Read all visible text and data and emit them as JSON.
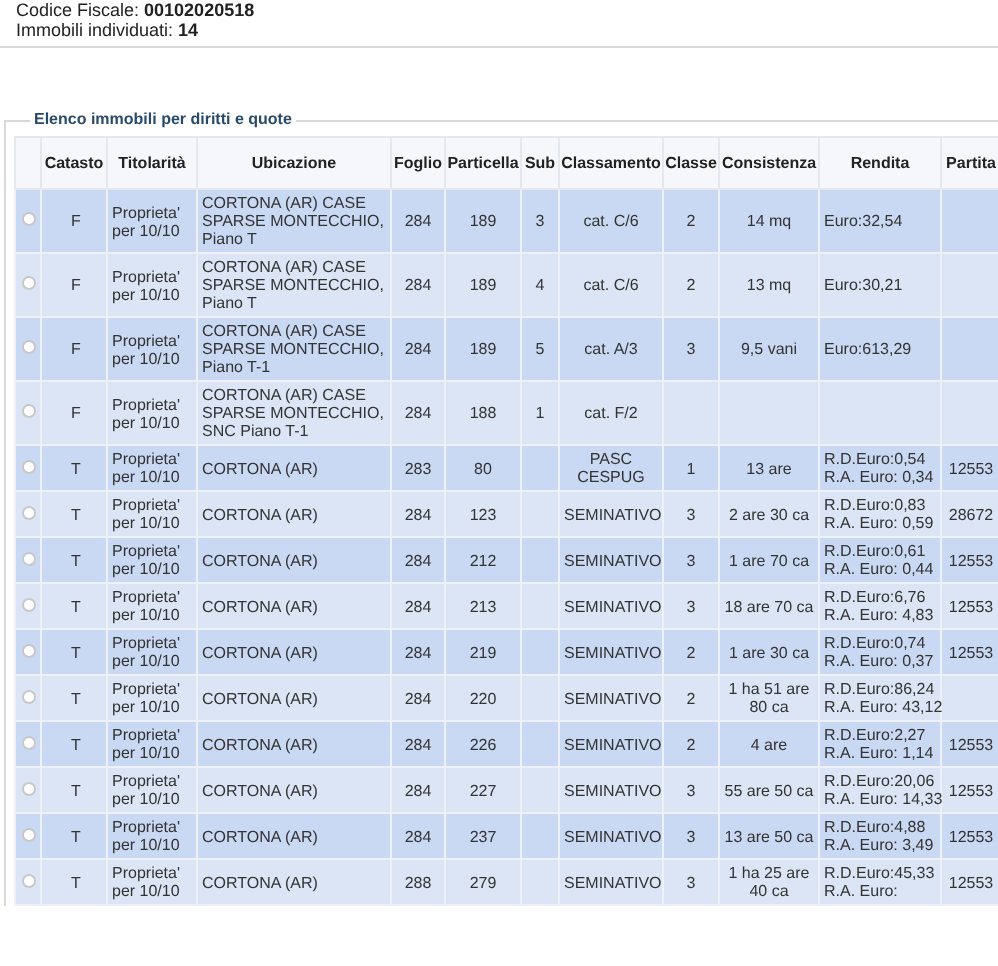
{
  "summary": {
    "codice_fiscale": "Codice Fiscale: **00102020518**",
    "immobili": "Immobili individuati: **14**"
  },
  "section": {
    "legend": "Elenco immobili per diritti e quote"
  },
  "table": {
    "columns": [
      "Catasto",
      "Titolarità",
      "Ubicazione",
      "Foglio",
      "Particella",
      "Sub",
      "Classamento",
      "Classe",
      "Consistenza",
      "Rendita",
      "Partita"
    ],
    "rows": [
      {
        "selected": false,
        "catasto": "F",
        "titolarita": "Proprieta' per 10/10",
        "ubicazione": "CORTONA (AR) CASE SPARSE MONTECCHIO, Piano T",
        "foglio": "284",
        "particella": "189",
        "sub": "3",
        "classamento": "cat. C/6",
        "classe": "2",
        "consistenza": "14 mq",
        "rendita": [
          "Euro:32,54"
        ]
      },
      {
        "selected": false,
        "catasto": "F",
        "titolarita": "Proprieta' per 10/10",
        "ubicazione": "CORTONA (AR) CASE SPARSE MONTECCHIO, Piano T",
        "foglio": "284",
        "particella": "189",
        "sub": "4",
        "classamento": "cat. C/6",
        "classe": "2",
        "consistenza": "13 mq",
        "rendita": [
          "Euro:30,21"
        ]
      },
      {
        "selected": false,
        "catasto": "F",
        "titolarita": "Proprieta' per 10/10",
        "ubicazione": "CORTONA (AR) CASE SPARSE MONTECCHIO, Piano T-1",
        "foglio": "284",
        "particella": "189",
        "sub": "5",
        "classamento": "cat. A/3",
        "classe": "3",
        "consistenza": "9,5 vani",
        "rendita": [
          "Euro:613,29"
        ]
      },
      {
        "selected": false,
        "catasto": "F",
        "titolarita": "Proprieta' per 10/10",
        "ubicazione": "CORTONA (AR) CASE SPARSE MONTECCHIO, SNC Piano T-1",
        "foglio": "284",
        "particella": "188",
        "sub": "1",
        "classamento": "cat. F/2"
      },
      {
        "selected": false,
        "catasto": "T",
        "titolarita": "Proprieta' per 10/10",
        "ubicazione": "CORTONA (AR)",
        "foglio": "283",
        "particella": "80",
        "classamento": "PASC CESPUG",
        "classe": "1",
        "consistenza": "13 are",
        "rendita": [
          "R.D.Euro:0,54",
          "R.A. Euro: 0,34"
        ],
        "partita": "12553"
      },
      {
        "selected": false,
        "catasto": "T",
        "titolarita": "Proprieta' per 10/10",
        "ubicazione": "CORTONA (AR)",
        "foglio": "284",
        "particella": "123",
        "classamento": "SEMINATIVO",
        "classe": "3",
        "consistenza": "2 are 30 ca",
        "rendita": [
          "R.D.Euro:0,83",
          "R.A. Euro: 0,59"
        ],
        "partita": "28672"
      },
      {
        "selected": false,
        "catasto": "T",
        "titolarita": "Proprieta' per 10/10",
        "ubicazione": "CORTONA (AR)",
        "foglio": "284",
        "particella": "212",
        "classamento": "SEMINATIVO",
        "classe": "3",
        "consistenza": "1 are 70 ca",
        "rendita": [
          "R.D.Euro:0,61",
          "R.A. Euro: 0,44"
        ],
        "partita": "12553"
      },
      {
        "selected": false,
        "catasto": "T",
        "titolarita": "Proprieta' per 10/10",
        "ubicazione": "CORTONA (AR)",
        "foglio": "284",
        "particella": "213",
        "classamento": "SEMINATIVO",
        "classe": "3",
        "consistenza": "18 are 70 ca",
        "rendita": [
          "R.D.Euro:6,76",
          "R.A. Euro: 4,83"
        ],
        "partita": "12553"
      },
      {
        "selected": false,
        "catasto": "T",
        "titolarita": "Proprieta' per 10/10",
        "ubicazione": "CORTONA (AR)",
        "foglio": "284",
        "particella": "219",
        "classamento": "SEMINATIVO",
        "classe": "2",
        "consistenza": "1 are 30 ca",
        "rendita": [
          "R.D.Euro:0,74",
          "R.A. Euro: 0,37"
        ],
        "partita": "12553"
      },
      {
        "selected": false,
        "catasto": "T",
        "titolarita": "Proprieta' per 10/10",
        "ubicazione": "CORTONA (AR)",
        "foglio": "284",
        "particella": "220",
        "classamento": "SEMINATIVO",
        "classe": "2",
        "consistenza": "1 ha 51 are 80 ca",
        "rendita": [
          "R.D.Euro:86,24",
          "R.A. Euro: 43,12"
        ]
      },
      {
        "selected": false,
        "catasto": "T",
        "titolarita": "Proprieta' per 10/10",
        "ubicazione": "CORTONA (AR)",
        "foglio": "284",
        "particella": "226",
        "classamento": "SEMINATIVO",
        "classe": "2",
        "consistenza": "4 are",
        "rendita": [
          "R.D.Euro:2,27",
          "R.A. Euro: 1,14"
        ],
        "partita": "12553"
      },
      {
        "selected": false,
        "catasto": "T",
        "titolarita": "Proprieta' per 10/10",
        "ubicazione": "CORTONA (AR)",
        "foglio": "284",
        "particella": "227",
        "classamento": "SEMINATIVO",
        "classe": "3",
        "consistenza": "55 are 50 ca",
        "rendita": [
          "R.D.Euro:20,06",
          "R.A. Euro: 14,33"
        ],
        "partita": "12553"
      },
      {
        "selected": false,
        "catasto": "T",
        "titolarita": "Proprieta' per 10/10",
        "ubicazione": "CORTONA (AR)",
        "foglio": "284",
        "particella": "237",
        "classamento": "SEMINATIVO",
        "classe": "3",
        "consistenza": "13 are 50 ca",
        "rendita": [
          "R.D.Euro:4,88",
          "R.A. Euro: 3,49"
        ],
        "partita": "12553"
      },
      {
        "selected": false,
        "catasto": "T",
        "titolarita": "Proprieta' per 10/10",
        "ubicazione": "CORTONA (AR)",
        "foglio": "288",
        "particella": "279",
        "classamento": "SEMINATIVO",
        "classe": "3",
        "consistenza": "1 ha 25 are 40 ca",
        "rendita": [
          "R.D.Euro:45,33",
          "R.A. Euro:"
        ],
        "partita": "12553"
      }
    ]
  }
}
